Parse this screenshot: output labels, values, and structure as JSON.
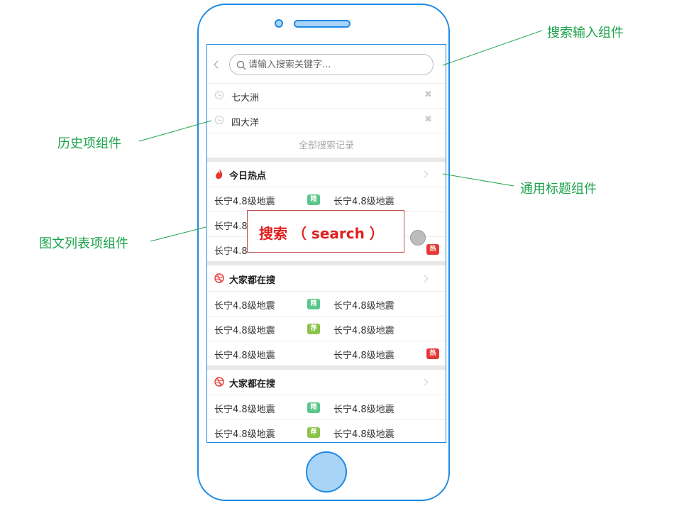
{
  "search": {
    "placeholder": "请输入搜索关键字..."
  },
  "history": {
    "items": [
      "七大洲",
      "四大洋"
    ],
    "all_label": "全部搜索记录"
  },
  "sections": [
    {
      "title": "今日热点",
      "icon": "fire-icon",
      "rows": [
        {
          "left": "长宁4.8级地震",
          "left_badge": "精",
          "right": "长宁4.8级地震",
          "right_badge": ""
        },
        {
          "left": "长宁4.8",
          "left_badge": "",
          "right": "",
          "right_badge": ""
        },
        {
          "left": "长宁4.8",
          "left_badge": "",
          "right": "",
          "right_badge": "热"
        }
      ]
    },
    {
      "title": "大家都在搜",
      "icon": "dribbble-icon",
      "rows": [
        {
          "left": "长宁4.8级地震",
          "left_badge": "精",
          "right": "长宁4.8级地震",
          "right_badge": ""
        },
        {
          "left": "长宁4.8级地震",
          "left_badge": "荐",
          "right": "长宁4.8级地震",
          "right_badge": ""
        },
        {
          "left": "长宁4.8级地震",
          "left_badge": "",
          "right": "长宁4.8级地震",
          "right_badge": "热"
        }
      ]
    },
    {
      "title": "大家都在搜",
      "icon": "dribbble-icon",
      "rows": [
        {
          "left": "长宁4.8级地震",
          "left_badge": "精",
          "right": "长宁4.8级地震",
          "right_badge": ""
        },
        {
          "left": "长宁4.8级地震",
          "left_badge": "荐",
          "right": "长宁4.8级地震",
          "right_badge": ""
        }
      ]
    }
  ],
  "popup": {
    "label": "搜索 （ search ）"
  },
  "annotations": {
    "search_component": "搜索输入组件",
    "history_component": "历史项组件",
    "title_component": "通用标题组件",
    "list_component": "图文列表项组件"
  },
  "colors": {
    "frame": "#1e8ae6",
    "annotation": "#1aa34a",
    "badge_jing": "#58c88a",
    "badge_jian": "#8bc34a",
    "badge_re": "#e53935",
    "popup_text": "#e02020"
  }
}
